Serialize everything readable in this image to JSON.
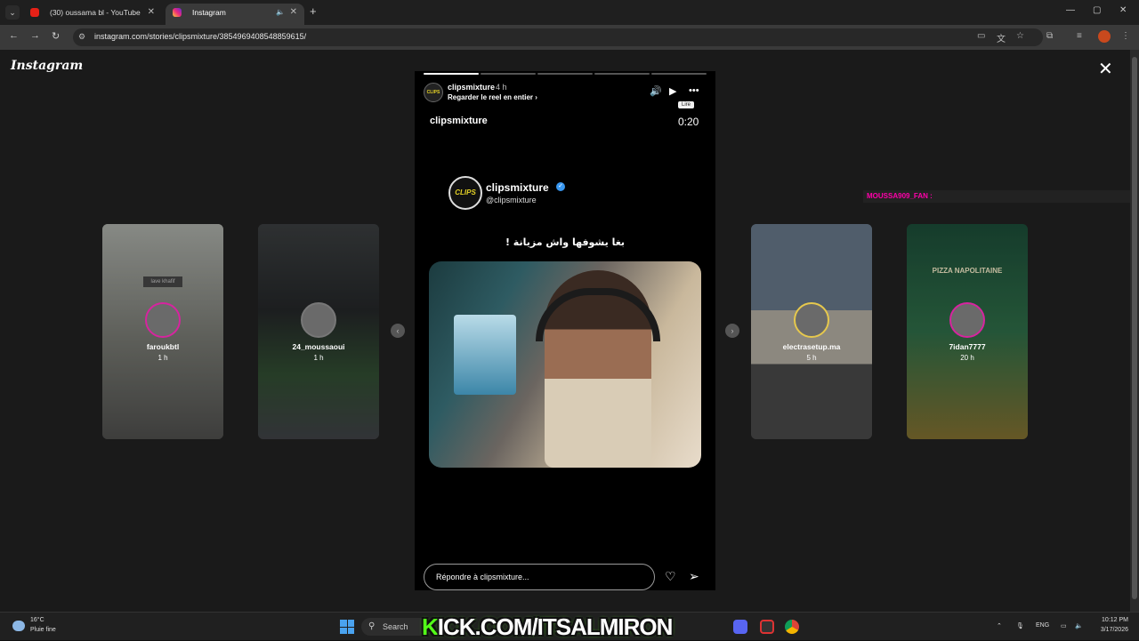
{
  "browser": {
    "tabs": [
      {
        "label": "(30) oussama bl - YouTube",
        "favicon": "youtube-icon"
      },
      {
        "label": "Instagram",
        "favicon": "instagram-icon"
      }
    ],
    "url": "instagram.com/stories/clipsmixture/3854969408548859615/"
  },
  "instagram": {
    "logo": "Instagram",
    "story": {
      "username": "clipsmixture",
      "age": "4 h",
      "subtitle": "Regarder le reel en entier ›",
      "avatar_text": "CLIPS",
      "tooltip": "Lire",
      "video_title": "clipsmixture",
      "time": "0:20",
      "progress_segments": 5,
      "progress_done": 1,
      "channel_name": "clipsmixture",
      "channel_handle": "@clipsmixture",
      "channel_badge": "CLIPS",
      "caption": "بغا يشوفها واش مزيانة !",
      "reply_placeholder": "Répondre à clipsmixture..."
    },
    "side_stories": [
      {
        "username": "faroukbtl",
        "time": "1 h",
        "tag": "lave khafif"
      },
      {
        "username": "24_moussaoui",
        "time": "1 h"
      },
      {
        "username": "electrasetup.ma",
        "time": "5 h"
      },
      {
        "username": "7idan7777",
        "time": "20 h",
        "title": "PIZZA NAPOLITAINE"
      }
    ],
    "overlay_comment": "MOUSSA909_FAN :"
  },
  "taskbar": {
    "weather_temp": "16°C",
    "weather_desc": "Pluie fine",
    "search": "Search",
    "overlay_text_prefix": "K",
    "overlay_text": "ICK.COM/ITSALMIRON",
    "lang": "ENG",
    "time": "10:12 PM",
    "date": "3/17/2026"
  },
  "colors": {
    "instagram_gradient": [
      "#f9ce34",
      "#ee2a7b",
      "#6228d7"
    ],
    "kick_green": "#53fc18",
    "verified_blue": "#3897f0"
  }
}
